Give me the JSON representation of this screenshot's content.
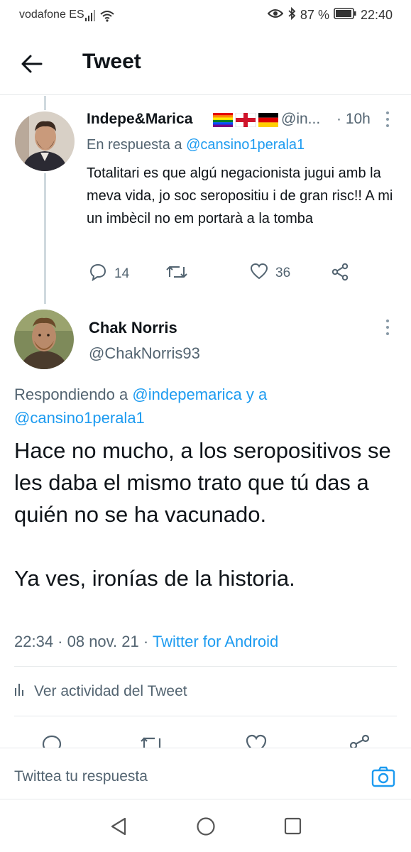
{
  "status": {
    "carrier": "vodafone ES",
    "battery": "87 %",
    "time": "22:40"
  },
  "header": {
    "title": "Tweet"
  },
  "parent_tweet": {
    "name": "Indepe&Marica",
    "handle": "@in...",
    "time": "· 10h",
    "reply_prefix": "En respuesta a",
    "reply_to": "@cansino1perala1",
    "text": "Totalitari es que algú negacionista jugui amb la meva vida, jo soc seropositiu i de gran risc!! A mi un imbècil no em portarà a la tomba",
    "replies": "14",
    "likes": "36"
  },
  "main_tweet": {
    "name": "Chak Norris",
    "handle": "@ChakNorris93",
    "reply_prefix": "Respondiendo a",
    "reply_to_1": "@indepemarica",
    "reply_join": "y a",
    "reply_to_2": "@cansino1perala1",
    "text_p1": "Hace no mucho, a los seropositivos se les daba el mismo trato que tú das a quién no se ha vacunado.",
    "text_p2": "Ya ves, ironías de la historia.",
    "timestamp": "22:34 · 08 nov. 21 ·",
    "source": "Twitter for Android",
    "activity_label": "Ver actividad del Tweet"
  },
  "reply_bar": {
    "placeholder": "Twittea tu respuesta"
  },
  "colors": {
    "accent": "#1d9bf0",
    "text": "#0f1419",
    "muted": "#536471",
    "divider": "#e6e9eb"
  },
  "icons": [
    "back-arrow-icon",
    "reply-icon",
    "retweet-icon",
    "like-icon",
    "share-icon",
    "more-icon",
    "stats-icon",
    "camera-icon",
    "nav-back-icon",
    "nav-home-icon",
    "nav-recents-icon"
  ]
}
